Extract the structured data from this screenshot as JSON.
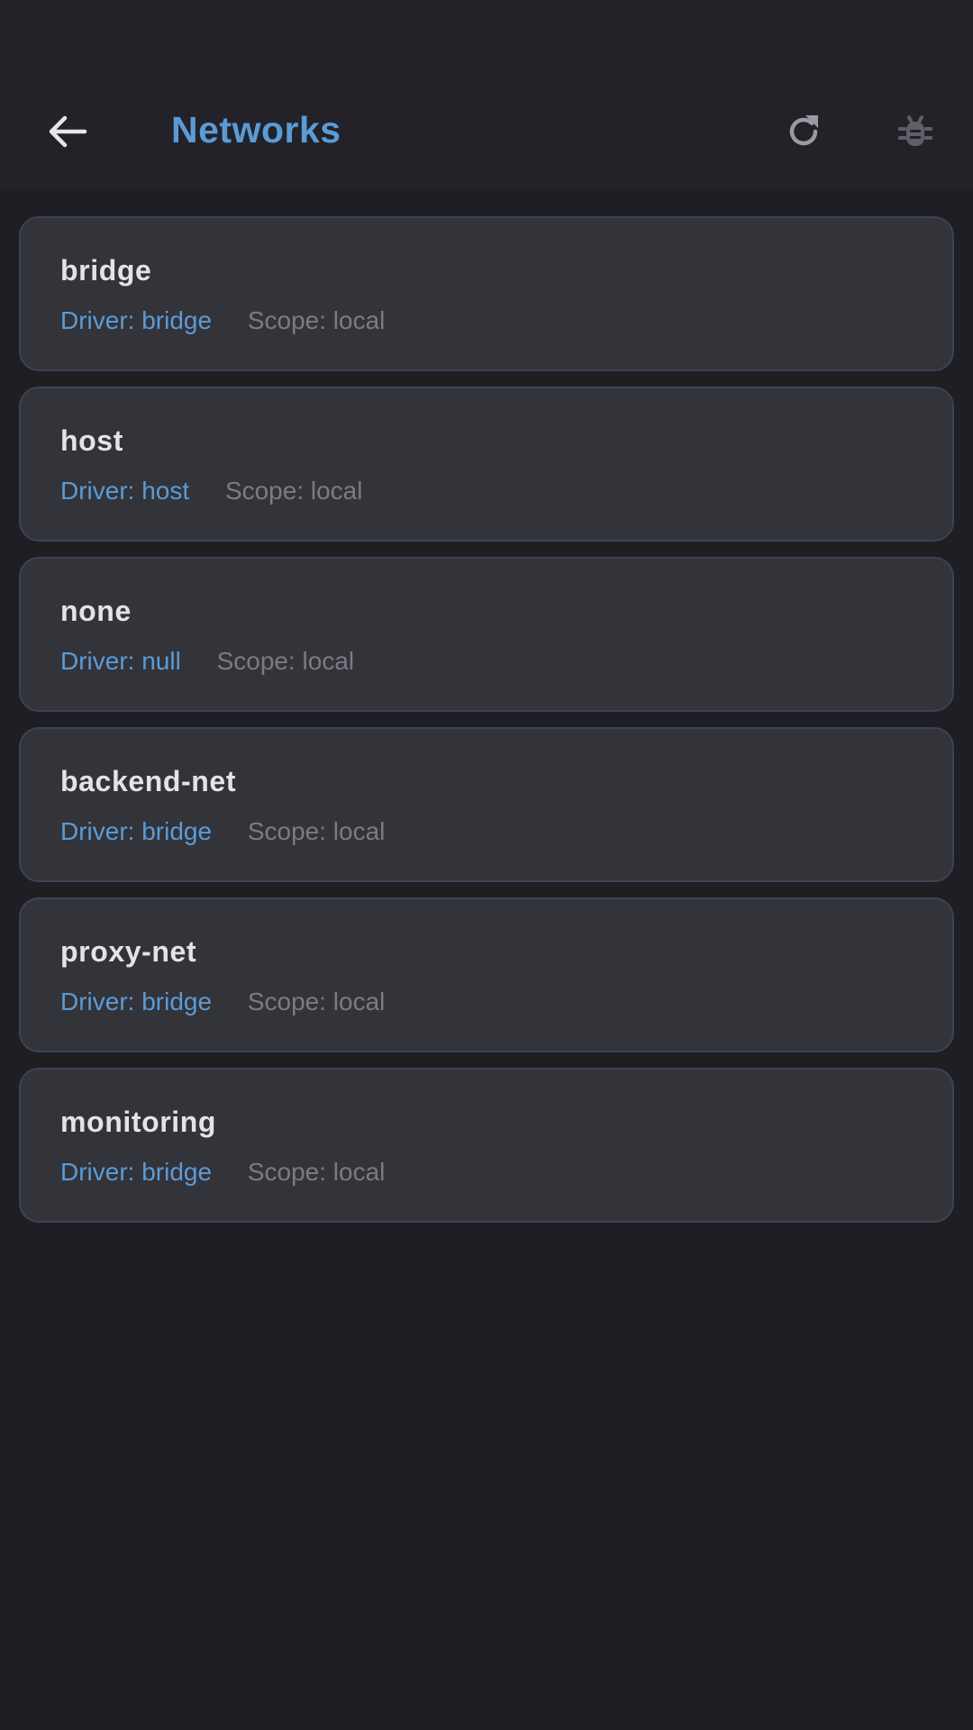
{
  "header": {
    "title": "Networks",
    "back_icon": "arrow-left-icon",
    "refresh_icon": "refresh-icon",
    "debug_icon": "bug-icon"
  },
  "colors": {
    "background": "#1e1e23",
    "app_bar": "#222228",
    "card": "#33333a",
    "card_border": "#3a4456",
    "accent": "#5b9bd5",
    "name_text": "#e3e3e8",
    "muted_text": "#7b7b83"
  },
  "networks": [
    {
      "name": "bridge",
      "driver": "Driver: bridge",
      "scope": "Scope: local"
    },
    {
      "name": "host",
      "driver": "Driver: host",
      "scope": "Scope: local"
    },
    {
      "name": "none",
      "driver": "Driver: null",
      "scope": "Scope: local"
    },
    {
      "name": "backend-net",
      "driver": "Driver: bridge",
      "scope": "Scope: local"
    },
    {
      "name": "proxy-net",
      "driver": "Driver: bridge",
      "scope": "Scope: local"
    },
    {
      "name": "monitoring",
      "driver": "Driver: bridge",
      "scope": "Scope: local"
    }
  ]
}
